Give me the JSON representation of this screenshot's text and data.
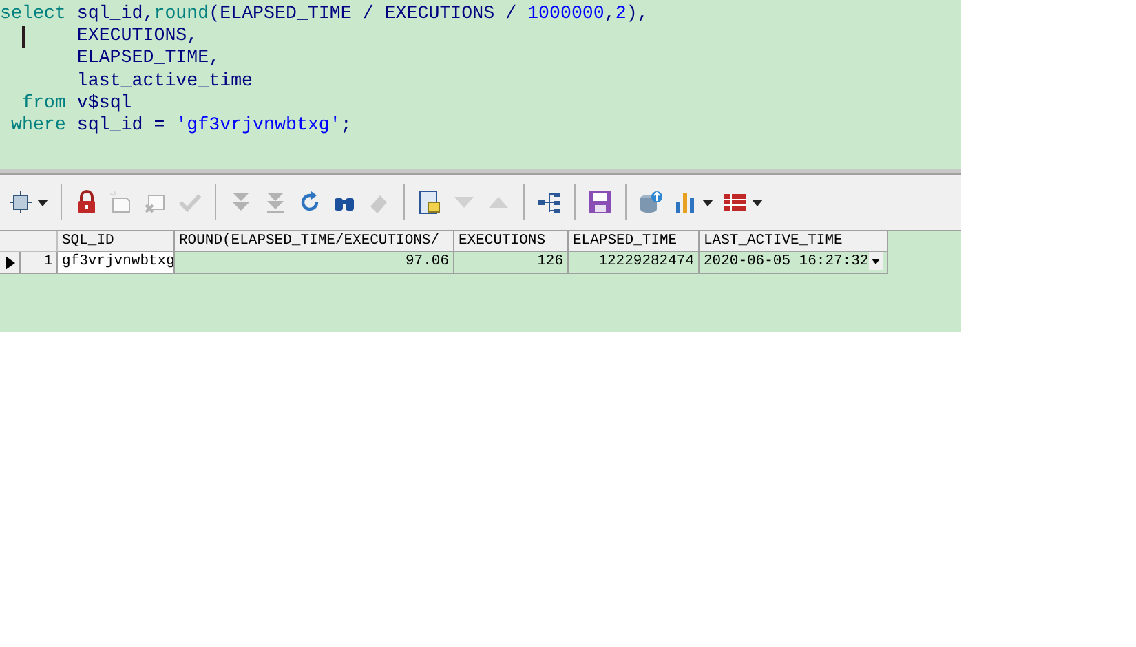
{
  "editor": {
    "lines": [
      [
        {
          "text": "select ",
          "kind": "keyword"
        },
        {
          "text": "sql_id,",
          "kind": "ident"
        },
        {
          "text": "round",
          "kind": "keyword"
        },
        {
          "text": "(ELAPSED_TIME / EXECUTIONS / ",
          "kind": "ident"
        },
        {
          "text": "1000000",
          "kind": "number"
        },
        {
          "text": ",",
          "kind": "ident"
        },
        {
          "text": "2",
          "kind": "number"
        },
        {
          "text": "),",
          "kind": "ident"
        }
      ],
      [
        {
          "text": "       EXECUTIONS,",
          "kind": "ident"
        }
      ],
      [
        {
          "text": "       ELAPSED_TIME,",
          "kind": "ident"
        }
      ],
      [
        {
          "text": "       last_active_time",
          "kind": "ident"
        }
      ],
      [
        {
          "text": "  from ",
          "kind": "keyword"
        },
        {
          "text": "v$sql",
          "kind": "ident"
        }
      ],
      [
        {
          "text": " where ",
          "kind": "keyword"
        },
        {
          "text": "sql_id = ",
          "kind": "ident"
        },
        {
          "text": "'gf3vrjvnwbtxg'",
          "kind": "string"
        },
        {
          "text": ";",
          "kind": "ident"
        }
      ]
    ]
  },
  "toolbar": [
    {
      "kind": "layout",
      "disabled": false,
      "menu": true
    },
    {
      "kind": "sep"
    },
    {
      "kind": "lock",
      "disabled": false
    },
    {
      "kind": "new-record",
      "disabled": true
    },
    {
      "kind": "delete-record",
      "disabled": true
    },
    {
      "kind": "check",
      "disabled": true
    },
    {
      "kind": "sep"
    },
    {
      "kind": "fetch-next",
      "disabled": true
    },
    {
      "kind": "fetch-all",
      "disabled": true
    },
    {
      "kind": "refresh",
      "disabled": false
    },
    {
      "kind": "find",
      "disabled": false
    },
    {
      "kind": "eraser",
      "disabled": true
    },
    {
      "kind": "sep"
    },
    {
      "kind": "form",
      "disabled": false
    },
    {
      "kind": "down",
      "disabled": true
    },
    {
      "kind": "up",
      "disabled": true
    },
    {
      "kind": "sep"
    },
    {
      "kind": "tree",
      "disabled": false
    },
    {
      "kind": "sep"
    },
    {
      "kind": "save",
      "disabled": false
    },
    {
      "kind": "sep"
    },
    {
      "kind": "database",
      "disabled": false
    },
    {
      "kind": "chart",
      "disabled": false,
      "menu": true
    },
    {
      "kind": "table",
      "disabled": false,
      "menu": true
    }
  ],
  "grid": {
    "columns": [
      {
        "name": "SQL_ID",
        "kind": "text"
      },
      {
        "name": "ROUND(ELAPSED_TIME/EXECUTIONS/",
        "kind": "number"
      },
      {
        "name": "EXECUTIONS",
        "kind": "number"
      },
      {
        "name": "ELAPSED_TIME",
        "kind": "number"
      },
      {
        "name": "LAST_ACTIVE_TIME",
        "kind": "date"
      }
    ],
    "rows": [
      {
        "number": "1",
        "selected": true,
        "cells": [
          "gf3vrjvnwbtxg",
          "97.06",
          "126",
          "12229282474",
          "2020-06-05 16:27:32"
        ]
      }
    ]
  }
}
